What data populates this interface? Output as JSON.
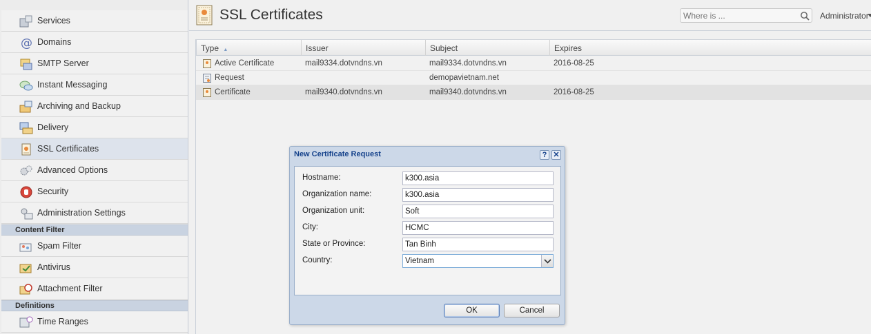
{
  "sidebar": {
    "items": [
      {
        "label": "Services",
        "icon": "services-icon"
      },
      {
        "label": "Domains",
        "icon": "at-icon"
      },
      {
        "label": "SMTP Server",
        "icon": "smtp-icon"
      },
      {
        "label": "Instant Messaging",
        "icon": "chat-icon"
      },
      {
        "label": "Archiving and Backup",
        "icon": "archive-icon"
      },
      {
        "label": "Delivery",
        "icon": "delivery-icon"
      },
      {
        "label": "SSL Certificates",
        "icon": "certificate-icon",
        "active": true
      },
      {
        "label": "Advanced Options",
        "icon": "gears-icon"
      },
      {
        "label": "Security",
        "icon": "stop-hand-icon"
      },
      {
        "label": "Administration Settings",
        "icon": "admin-icon"
      }
    ],
    "content_filter_header": "Content Filter",
    "content_filter_items": [
      {
        "label": "Spam Filter",
        "icon": "spam-icon"
      },
      {
        "label": "Antivirus",
        "icon": "antivirus-icon"
      },
      {
        "label": "Attachment Filter",
        "icon": "attachment-icon"
      }
    ],
    "definitions_header": "Definitions",
    "definitions_items": [
      {
        "label": "Time Ranges",
        "icon": "clock-icon"
      }
    ]
  },
  "header": {
    "title": "SSL Certificates",
    "search_placeholder": "Where is ...",
    "user": "Administrator"
  },
  "grid": {
    "columns": [
      "Type",
      "Issuer",
      "Subject",
      "Expires"
    ],
    "sort_indicator": "▲",
    "rows": [
      {
        "type": "Active Certificate",
        "issuer": "mail9334.dotvndns.vn",
        "subject": "mail9334.dotvndns.vn",
        "expires": "2016-08-25"
      },
      {
        "type": "Request",
        "issuer": "",
        "subject": "demopavietnam.net",
        "expires": ""
      },
      {
        "type": "Certificate",
        "issuer": "mail9340.dotvndns.vn",
        "subject": "mail9340.dotvndns.vn",
        "expires": "2016-08-25",
        "selected": true
      }
    ]
  },
  "dialog": {
    "title": "New Certificate Request",
    "help": "?",
    "close": "✕",
    "fields": [
      {
        "label": "Hostname:",
        "value": "k300.asia"
      },
      {
        "label": "Organization name:",
        "value": "k300.asia"
      },
      {
        "label": "Organization unit:",
        "value": "Soft"
      },
      {
        "label": "City:",
        "value": "HCMC"
      },
      {
        "label": "State or Province:",
        "value": "Tan Binh"
      }
    ],
    "country_label": "Country:",
    "country_value": "Vietnam",
    "ok": "OK",
    "cancel": "Cancel"
  },
  "colors": {
    "accent": "#15428b",
    "dialog_frame": "#ccd8e8",
    "sidebar_header": "#c9d3e1"
  }
}
